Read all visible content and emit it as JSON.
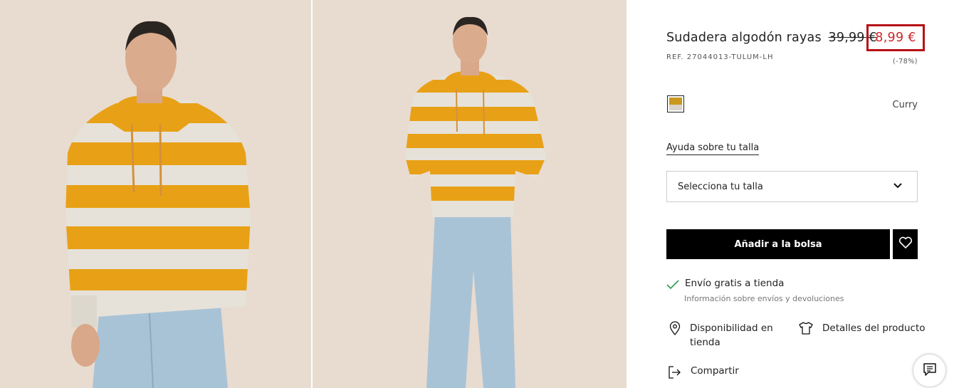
{
  "product": {
    "name": "Sudadera algodón rayas",
    "old_price": "39,99 €",
    "sale_price": "8,99 €",
    "ref": "REF. 27044013-TULUM-LH",
    "discount": "(-78%)"
  },
  "color": {
    "name": "Curry"
  },
  "size": {
    "help_link": "Ayuda sobre tu talla",
    "select_placeholder": "Selecciona tu talla"
  },
  "actions": {
    "add_to_bag": "Añadir a la bolsa"
  },
  "shipping": {
    "title": "Envío gratis a tienda",
    "info_link": "Información sobre envíos y devoluciones"
  },
  "links": {
    "store_availability": "Disponibilidad en tienda",
    "product_details": "Detalles del producto",
    "share": "Compartir"
  },
  "icons": [
    "check-icon",
    "location-pin-icon",
    "tshirt-icon",
    "share-icon",
    "heart-icon",
    "chevron-down-icon",
    "chat-icon"
  ],
  "colors": {
    "sale": "#d0262b",
    "sale_border": "#b70f16",
    "stripe_yellow": "#e8a116",
    "stripe_white": "#e6e2da",
    "jeans": "#a9c3d6",
    "background": "#e8dbd0"
  }
}
